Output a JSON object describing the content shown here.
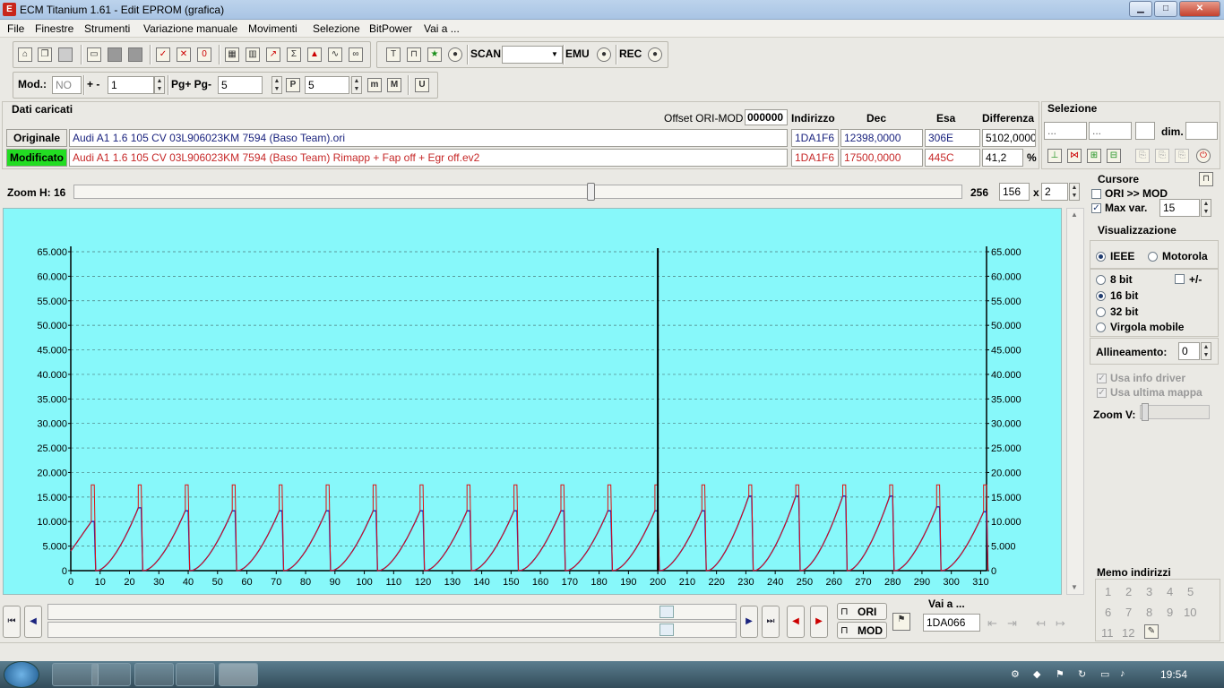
{
  "window": {
    "title": "ECM Titanium 1.61 - Edit EPROM (grafica)",
    "minimize": "▁",
    "maximize": "□",
    "close": "✕"
  },
  "menu": [
    "File",
    "Finestre",
    "Strumenti",
    "Variazione manuale",
    "Movimenti",
    "Selezione",
    "BitPower",
    "Vai a ..."
  ],
  "toolbar1": {
    "scan_label": "SCAN",
    "emu_label": "EMU",
    "rec_label": "REC",
    "scan_value": ""
  },
  "toolbar2": {
    "mod_label": "Mod.:",
    "mod_value": "NO",
    "plusminus_label": "+ -",
    "plusminus_value": "1",
    "pg_label": "Pg+ Pg-",
    "pg_value": "5",
    "p_value": "5",
    "p_icon": "P",
    "m_icon": "m",
    "M_icon": "M",
    "U_icon": "U"
  },
  "loaded": {
    "title": "Dati caricati",
    "offset_label": "Offset ORI-MOD",
    "offset_value": "000000",
    "col_indirizzo": "Indirizzo",
    "col_dec": "Dec",
    "col_esa": "Esa",
    "col_diff": "Differenza",
    "original": {
      "label": "Originale",
      "file": "Audi A1 1.6 105 CV 03L906023KM 7594 (Baso Team).ori",
      "addr": "1DA1F6",
      "dec": "12398,0000",
      "hex": "306E",
      "diff": "5102,0000"
    },
    "modified": {
      "label": "Modificato",
      "file": "Audi A1 1.6 105 CV 03L906023KM 7594 (Baso Team) Rimapp + Fap off + Egr off.ev2",
      "addr": "1DA1F6",
      "dec": "17500,0000",
      "hex": "445C",
      "diff": "41,2",
      "pct": "%"
    }
  },
  "selezione": {
    "title": "Selezione",
    "f1": "...",
    "f2": "...",
    "f3": "",
    "dim_label": "dim.",
    "f4": ""
  },
  "zoom": {
    "label": "Zoom H: 16",
    "max": "256",
    "width_value": "156",
    "x_label": "x",
    "mult_value": "2"
  },
  "cursore": {
    "title": "Cursore",
    "ori_mod": "ORI >> MOD",
    "max_var": "Max var.",
    "max_var_value": "15"
  },
  "visual": {
    "title": "Visualizzazione",
    "ieee": "IEEE",
    "motorola": "Motorola",
    "bit8": "8 bit",
    "pm": "+/-",
    "bit16": "16 bit",
    "bit32": "32 bit",
    "virgola": "Virgola mobile",
    "allineamento": "Allineamento:",
    "allineamento_value": "0",
    "usa_info": "Usa info driver",
    "usa_mappa": "Usa ultima mappa",
    "zoom_v": "Zoom V:"
  },
  "memo": {
    "title": "Memo indirizzi",
    "slots": [
      "1",
      "2",
      "3",
      "4",
      "5",
      "6",
      "7",
      "8",
      "9",
      "10",
      "11",
      "12"
    ]
  },
  "bottom": {
    "vai_label": "Vai a ...",
    "vai_value": "1DA066",
    "ori_btn": "ORI",
    "mod_btn": "MOD"
  },
  "taskbar": {
    "clock": "19:54"
  },
  "colors": {
    "chart_bg": "#87f8fa",
    "series_mod": "#e01010",
    "series_ori": "#1020c0",
    "modified_label_bg": "#22dd22"
  },
  "chart_data": {
    "type": "line",
    "xlim": [
      0,
      312
    ],
    "ylim": [
      0,
      65000
    ],
    "x_ticks": [
      0,
      10,
      20,
      30,
      40,
      50,
      60,
      70,
      80,
      90,
      100,
      110,
      120,
      130,
      140,
      150,
      160,
      170,
      180,
      190,
      200,
      210,
      220,
      230,
      240,
      250,
      260,
      270,
      280,
      290,
      300,
      310
    ],
    "y_ticks": [
      0,
      5000,
      10000,
      15000,
      20000,
      25000,
      30000,
      35000,
      40000,
      45000,
      50000,
      55000,
      60000,
      65000
    ],
    "y_tick_labels": [
      "0",
      "5.000",
      "10.000",
      "15.000",
      "20.000",
      "25.000",
      "30.000",
      "35.000",
      "40.000",
      "45.000",
      "50.000",
      "55.000",
      "60.000",
      "65.000"
    ],
    "grid": true,
    "cursor_x": 200,
    "period": 16,
    "series": [
      {
        "peaks_x": [
          8,
          24,
          40,
          56,
          72,
          88,
          104,
          120,
          136,
          152,
          168,
          184,
          200,
          216,
          232,
          248,
          264,
          280,
          296,
          312
        ],
        "peak_value": 17500
      },
      {
        "peaks_x": [
          8,
          24,
          40,
          56,
          72,
          88,
          104,
          120,
          136,
          152,
          168,
          184,
          200,
          216,
          232,
          248,
          264,
          280,
          296,
          312
        ],
        "peak_values": [
          10000,
          12800,
          12200,
          12200,
          12200,
          12200,
          12200,
          12200,
          12200,
          12200,
          12200,
          12200,
          12200,
          12200,
          15200,
          15200,
          15200,
          15200,
          13000,
          12000
        ]
      }
    ]
  }
}
